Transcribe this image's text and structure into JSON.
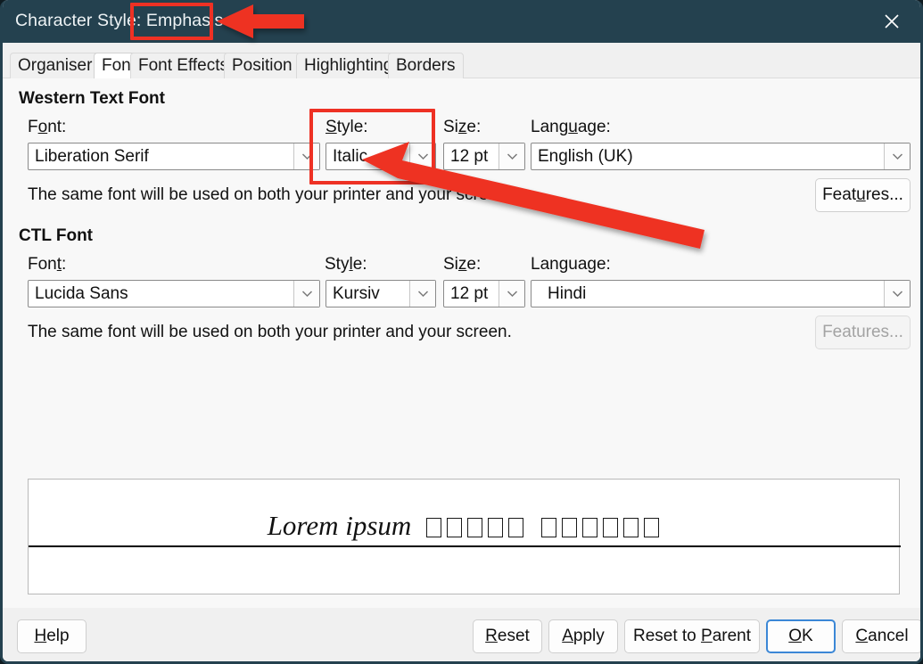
{
  "window": {
    "title_prefix": "Character Style: ",
    "title_value": "Emphasis",
    "close_icon": "close-icon"
  },
  "tabs": [
    {
      "label": "Organiser",
      "selected": false
    },
    {
      "label": "Font",
      "selected": true
    },
    {
      "label": "Font Effects",
      "selected": false
    },
    {
      "label": "Position",
      "selected": false
    },
    {
      "label": "Highlighting",
      "selected": false
    },
    {
      "label": "Borders",
      "selected": false
    }
  ],
  "western": {
    "section_title": "Western Text Font",
    "font_label_pre": "F",
    "font_label_key": "o",
    "font_label_post": "nt:",
    "style_label_pre": "",
    "style_label_key": "S",
    "style_label_post": "tyle:",
    "size_label_pre": "Si",
    "size_label_key": "z",
    "size_label_post": "e:",
    "language_label_pre": "Lang",
    "language_label_key": "u",
    "language_label_post": "age:",
    "font_value": "Liberation Serif",
    "style_value": "Italic",
    "size_value": "12 pt",
    "language_value": "English (UK)",
    "note": "The same font will be used on both your printer and your screen.",
    "features_pre": "Feat",
    "features_key": "u",
    "features_post": "res...",
    "features_enabled": true
  },
  "ctl": {
    "section_title": "CTL Font",
    "font_label_pre": "Fon",
    "font_label_key": "t",
    "font_label_post": ":",
    "style_label_pre": "Sty",
    "style_label_key": "l",
    "style_label_post": "e:",
    "size_label_pre": "Si",
    "size_label_key": "z",
    "size_label_post": "e:",
    "language_label_pre": "Language:",
    "language_label_key": "",
    "language_label_post": "",
    "font_value": "Lucida Sans",
    "style_value": "Kursiv",
    "size_value": "12 pt",
    "language_value": "Hindi",
    "note": "The same font will be used on both your printer and your screen.",
    "features_label": "Features...",
    "features_enabled": false
  },
  "preview": {
    "western_text": "Lorem ipsum",
    "ctl_tofu_group_1": 5,
    "ctl_tofu_group_2": 6
  },
  "footer": {
    "help_pre": "",
    "help_key": "H",
    "help_post": "elp",
    "reset_pre": "",
    "reset_key": "R",
    "reset_post": "eset",
    "apply_pre": "",
    "apply_key": "A",
    "apply_post": "pply",
    "reset_parent_pre": "Reset to ",
    "reset_parent_key": "P",
    "reset_parent_post": "arent",
    "ok_pre": "",
    "ok_key": "O",
    "ok_post": "K",
    "cancel_pre": "",
    "cancel_key": "C",
    "cancel_post": "ancel"
  },
  "colors": {
    "titlebar": "#24414f",
    "annotation_red": "#ee3124",
    "focus_blue": "#3b87d6",
    "content_bg": "#f8f8f8"
  }
}
